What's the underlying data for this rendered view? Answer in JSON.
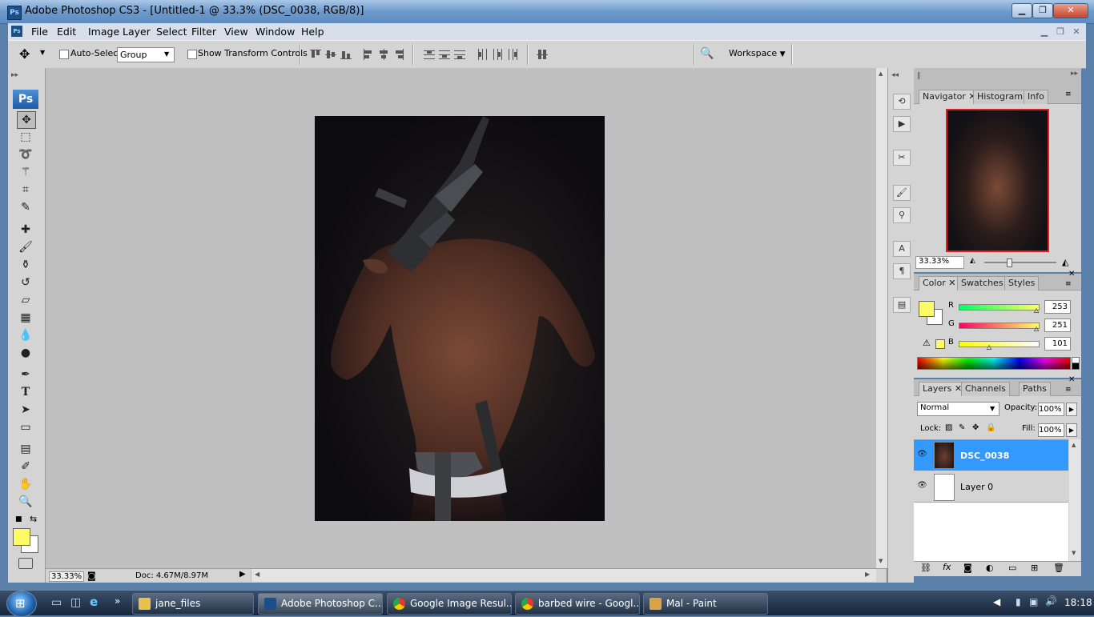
{
  "window": {
    "title": "Adobe Photoshop CS3 - [Untitled-1 @ 33.3% (DSC_0038, RGB/8)]",
    "app_badge": "Ps"
  },
  "menu": [
    "File",
    "Edit",
    "Image",
    "Layer",
    "Select",
    "Filter",
    "View",
    "Window",
    "Help"
  ],
  "options": {
    "auto_select_label": "Auto-Select:",
    "auto_select_value": "Group",
    "show_transform_label": "Show Transform Controls",
    "workspace_label": "Workspace"
  },
  "toolbox": {
    "logo": "Ps",
    "foreground_color": "#fdfb65",
    "background_color": "#ffffff"
  },
  "status": {
    "zoom": "33.33%",
    "doc": "Doc: 4.67M/8.97M"
  },
  "navigator": {
    "tabs": [
      "Navigator",
      "Histogram",
      "Info"
    ],
    "zoom": "33.33%"
  },
  "color_panel": {
    "tabs": [
      "Color",
      "Swatches",
      "Styles"
    ],
    "r_label": "R",
    "g_label": "G",
    "b_label": "B",
    "r": "253",
    "g": "251",
    "b": "101",
    "swatch": "#fdfb65"
  },
  "layers_panel": {
    "tabs": [
      "Layers",
      "Channels",
      "Paths"
    ],
    "blend_mode": "Normal",
    "opacity_label": "Opacity:",
    "opacity": "100%",
    "lock_label": "Lock:",
    "fill_label": "Fill:",
    "fill": "100%",
    "layers": [
      {
        "name": "DSC_0038",
        "selected": true
      },
      {
        "name": "Layer 0",
        "selected": false
      }
    ]
  },
  "taskbar": {
    "items": [
      "jane_files",
      "Adobe Photoshop C...",
      "Google Image Resul...",
      "barbed wire - Googl...",
      "Mal - Paint"
    ],
    "clock": "18:18"
  },
  "accent_color": "#3399ff"
}
